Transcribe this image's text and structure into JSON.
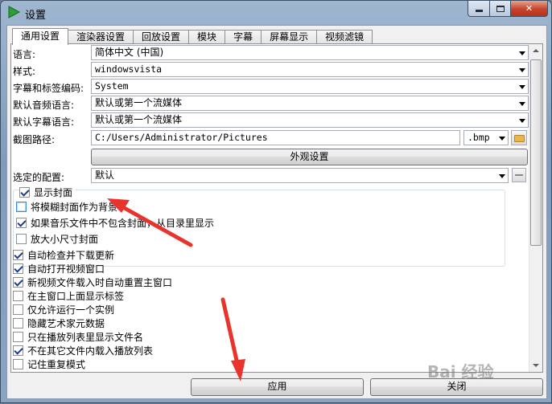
{
  "window": {
    "title": "设置"
  },
  "tabs": [
    {
      "label": "通用设置",
      "active": true
    },
    {
      "label": "渲染器设置",
      "active": false
    },
    {
      "label": "回放设置",
      "active": false
    },
    {
      "label": "模块",
      "active": false
    },
    {
      "label": "字幕",
      "active": false
    },
    {
      "label": "屏幕显示",
      "active": false
    },
    {
      "label": "视频滤镜",
      "active": false
    }
  ],
  "fields": {
    "language": {
      "label": "语言:",
      "value": "简体中文 (中国)"
    },
    "style": {
      "label": "样式:",
      "value": "windowsvista"
    },
    "encoding": {
      "label": "字幕和标签编码:",
      "value": "System"
    },
    "audio_lang": {
      "label": "默认音频语言:",
      "value": "默认或第一个流媒体"
    },
    "sub_lang": {
      "label": "默认字幕语言:",
      "value": "默认或第一个流媒体"
    },
    "screenshot_path": {
      "label": "截图路径:",
      "value": "C:/Users/Administrator/Pictures",
      "format": ".bmp"
    },
    "appearance_button": "外观设置",
    "profile": {
      "label": "选定的配置:",
      "value": "默认"
    }
  },
  "cover_group": {
    "title": "显示封面",
    "checked": true,
    "options": [
      {
        "label": "将模糊封面作为背景",
        "checked": false
      },
      {
        "label": "如果音乐文件中不包含封面，从目录里显示",
        "checked": true
      },
      {
        "label": "放大小尺寸封面",
        "checked": false
      }
    ]
  },
  "options": [
    {
      "label": "自动检查并下载更新",
      "checked": true
    },
    {
      "label": "自动打开视频窗口",
      "checked": true
    },
    {
      "label": "新视频文件载入时自动重置主窗口",
      "checked": true
    },
    {
      "label": "在主窗口上面显示标签",
      "checked": false
    },
    {
      "label": "仅允许运行一个实例",
      "checked": false
    },
    {
      "label": "隐藏艺术家元数据",
      "checked": false
    },
    {
      "label": "只在播放列表里显示文件名",
      "checked": false
    },
    {
      "label": "不在其它文件内载入播放列表",
      "checked": true
    },
    {
      "label": "记住重复模式",
      "checked": false
    }
  ],
  "footer": {
    "apply": "应用",
    "close": "关闭"
  },
  "watermark": "Bai 经验",
  "colors": {
    "annotation_arrow": "#e8342c",
    "check_mark": "#1c3d8c",
    "title_gradient_top": "#9fb6cf"
  }
}
